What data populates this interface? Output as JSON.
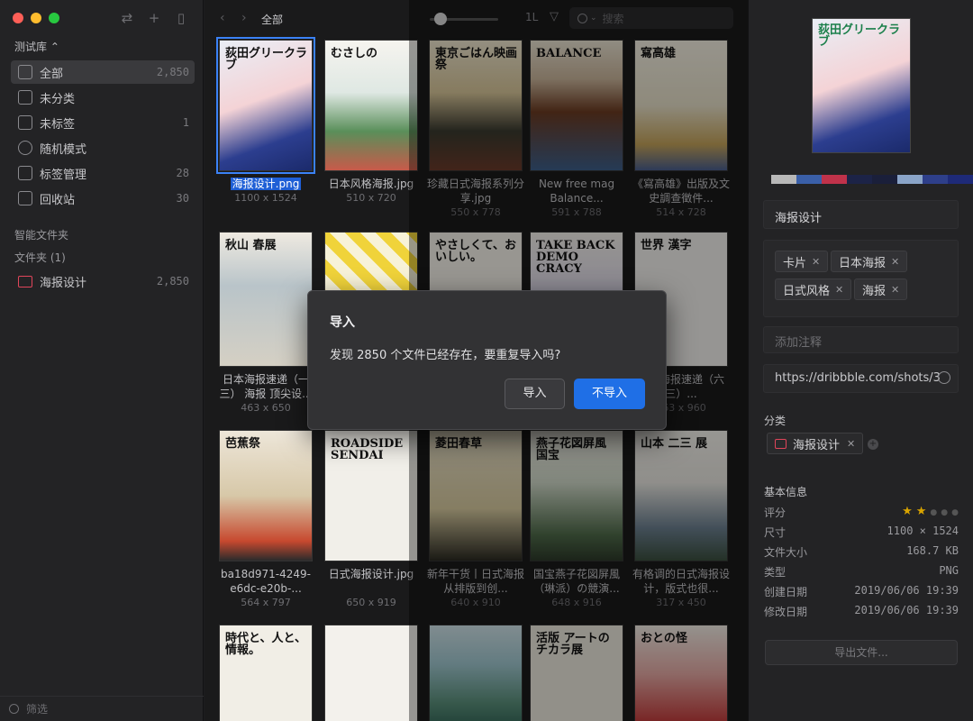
{
  "sidebar": {
    "library": "测试库 ⌃",
    "items": [
      {
        "label": "全部",
        "count": "2,850"
      },
      {
        "label": "未分类",
        "count": ""
      },
      {
        "label": "未标签",
        "count": "1"
      },
      {
        "label": "随机模式",
        "count": ""
      },
      {
        "label": "标签管理",
        "count": "28"
      },
      {
        "label": "回收站",
        "count": "30"
      }
    ],
    "smart_folders": "智能文件夹",
    "folders_head": "文件夹 (1)",
    "folder": {
      "label": "海报设计",
      "count": "2,850"
    },
    "filter": "筛选"
  },
  "toolbar": {
    "breadcrumb": "全部",
    "search_placeholder": "搜索",
    "sort_label": "1L"
  },
  "grid": [
    {
      "name": "海报设计.png",
      "size": "1100 x 1524",
      "poster": "p1",
      "text": "荻田グリークラブ"
    },
    {
      "name": "日本风格海报.jpg",
      "size": "510 x 720",
      "poster": "p2",
      "text": "むさしの"
    },
    {
      "name": "珍藏日式海报系列分享.jpg",
      "size": "550 x 778",
      "poster": "p3",
      "text": "東京ごはん映画祭"
    },
    {
      "name": "New free mag Balance...",
      "size": "591 x 788",
      "poster": "p4",
      "text": "BALANCE"
    },
    {
      "name": "《寫高雄》出版及文史調查徵件...",
      "size": "514 x 728",
      "poster": "p5",
      "text": "寫高雄"
    },
    {
      "name": "日本海报速递（一三） 海报 顶尖设...",
      "size": "463 x 650",
      "poster": "p6",
      "text": "秋山 春展"
    },
    {
      "name": "",
      "size": "",
      "poster": "p7",
      "text": ""
    },
    {
      "name": "",
      "size": "",
      "poster": "p8",
      "text": "やさしくて、おいしい。"
    },
    {
      "name": "",
      "size": "",
      "poster": "p9",
      "text": "TAKE BACK DEMO CRACY"
    },
    {
      "name": "日本海报速递（六三）...",
      "size": "463 x 960",
      "poster": "p10",
      "text": "世界 漢字"
    },
    {
      "name": "ba18d971-4249-e6dc-e20b-...",
      "size": "564 x 797",
      "poster": "p11",
      "text": "芭蕉祭"
    },
    {
      "name": "日式海报设计.jpg",
      "size": "650 x 919",
      "poster": "p12",
      "text": "ROADSIDE SENDAI"
    },
    {
      "name": "新年干货丨日式海报从排版到创...",
      "size": "640 x 910",
      "poster": "p13",
      "text": "菱田春草"
    },
    {
      "name": "国宝燕子花図屏風（琳派）の競演...",
      "size": "648 x 916",
      "poster": "p14",
      "text": "燕子花図屏風 国宝"
    },
    {
      "name": "有格调的日式海报设计，版式也很...",
      "size": "317 x 450",
      "poster": "p15",
      "text": "山本 二三 展"
    },
    {
      "name": "",
      "size": "",
      "poster": "p16",
      "text": "時代と、人と、情報。"
    },
    {
      "name": "",
      "size": "",
      "poster": "p17",
      "text": ""
    },
    {
      "name": "",
      "size": "",
      "poster": "p18",
      "text": ""
    },
    {
      "name": "",
      "size": "",
      "poster": "p19",
      "text": "活版 アートのチカラ展"
    },
    {
      "name": "",
      "size": "",
      "poster": "p20",
      "text": "おとの怪"
    }
  ],
  "inspector": {
    "preview_text": "荻田グリークラブ",
    "palette": [
      "#b8b8b8",
      "#3a5fa8",
      "#c0324a",
      "#1c2347",
      "#1a1f3a",
      "#8aa4c8",
      "#2e3f8a",
      "#1e2a78"
    ],
    "name": "海报设计",
    "tags": [
      "卡片",
      "日本海报",
      "日式风格",
      "海报"
    ],
    "note_placeholder": "添加注释",
    "url": "https://dribbble.com/shots/3",
    "category_head": "分类",
    "category": "海报设计",
    "basic_head": "基本信息",
    "rating_label": "评分",
    "rating": 2,
    "rows": [
      {
        "k": "尺寸",
        "v": "1100 × 1524"
      },
      {
        "k": "文件大小",
        "v": "168.7 KB"
      },
      {
        "k": "类型",
        "v": "PNG"
      },
      {
        "k": "创建日期",
        "v": "2019/06/06 19:39"
      },
      {
        "k": "修改日期",
        "v": "2019/06/06 19:39"
      }
    ],
    "export": "导出文件..."
  },
  "dialog": {
    "title": "导入",
    "message": "发现 2850 个文件已经存在，要重复导入吗?",
    "import_button": "导入",
    "skip_button": "不导入"
  }
}
